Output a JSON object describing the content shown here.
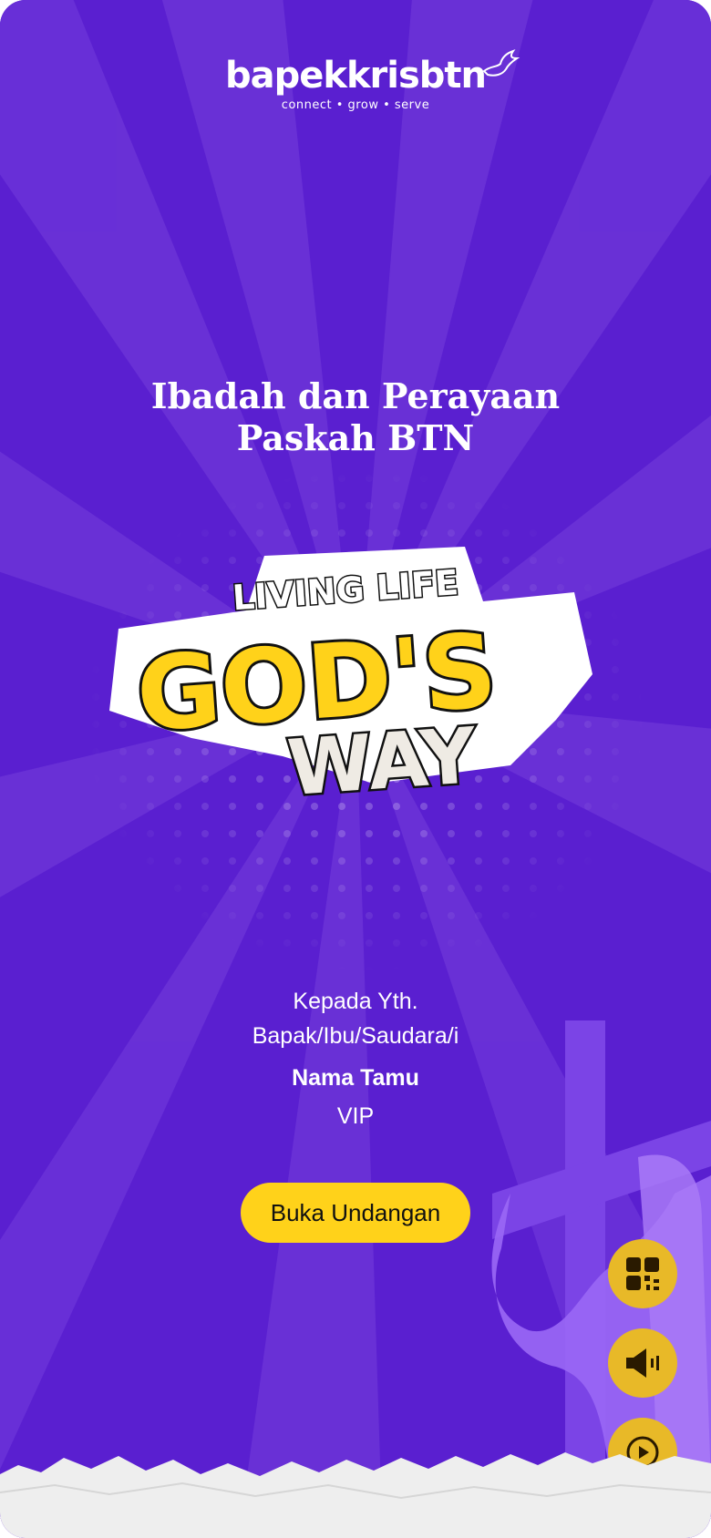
{
  "logo": {
    "name": "bapekkrisbtn",
    "tagline": "connect • grow • serve"
  },
  "title": {
    "line1": "Ibadah dan Perayaan",
    "line2": "Paskah BTN"
  },
  "hero": {
    "top_text": "LIVING LIFE",
    "main_text": "GOD'S",
    "bottom_text": "WAY"
  },
  "greeting": {
    "line1": "Kepada Yth.",
    "line2": "Bapak/Ibu/Saudara/i",
    "guest_name": "Nama Tamu",
    "guest_category": "VIP"
  },
  "actions": {
    "open_label": "Buka Undangan"
  },
  "floating_buttons": [
    {
      "icon": "qr-code-icon"
    },
    {
      "icon": "speaker-icon"
    },
    {
      "icon": "play-icon"
    }
  ],
  "colors": {
    "background": "#5a1fd0",
    "ray": "#6f3ad8",
    "accent_yellow": "#ffd21a",
    "fab_yellow": "#e8b928",
    "cross_purple": "#7b44e6"
  }
}
